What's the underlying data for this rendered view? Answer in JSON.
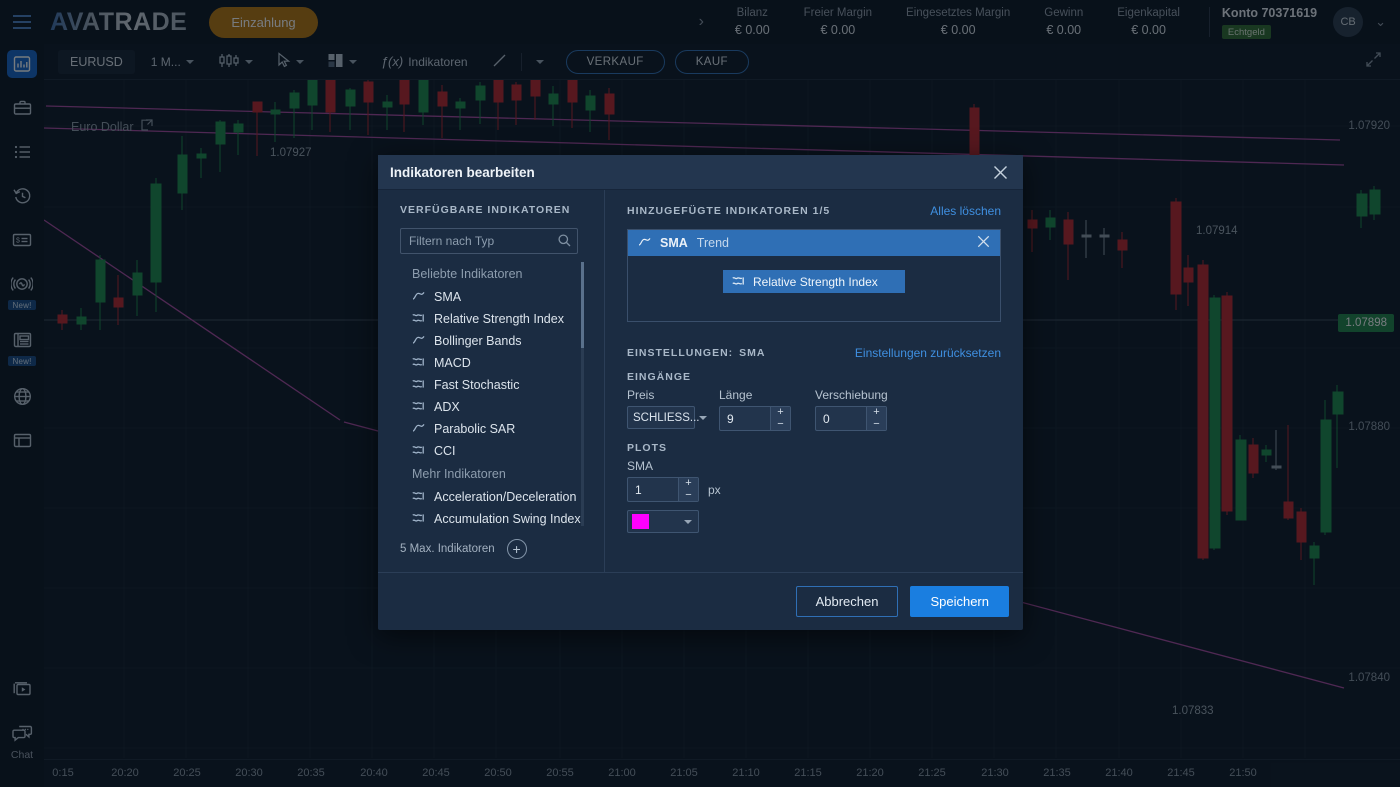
{
  "header": {
    "brand": "AVATRADE",
    "deposit_label": "Einzahlung",
    "expand_arrow": "›",
    "stats": [
      {
        "label": "Bilanz",
        "value": "€ 0.00"
      },
      {
        "label": "Freier Margin",
        "value": "€ 0.00"
      },
      {
        "label": "Eingesetztes Margin",
        "value": "€ 0.00"
      },
      {
        "label": "Gewinn",
        "value": "€ 0.00"
      },
      {
        "label": "Eigenkapital",
        "value": "€ 0.00"
      }
    ],
    "account_name": "Konto 70371619",
    "account_badge": "Echtgeld",
    "avatar_initials": "CB"
  },
  "sidebar": {
    "items": [
      {
        "name": "chart",
        "icon": "bar-chart-icon",
        "active": true,
        "badge": ""
      },
      {
        "name": "portfolio",
        "icon": "briefcase-icon",
        "active": false,
        "badge": ""
      },
      {
        "name": "watchlist",
        "icon": "list-icon",
        "active": false,
        "badge": ""
      },
      {
        "name": "history",
        "icon": "history-clock-icon",
        "active": false,
        "badge": ""
      },
      {
        "name": "transactions",
        "icon": "money-card-icon",
        "active": false,
        "badge": ""
      },
      {
        "name": "signals",
        "icon": "pulse-signal-icon",
        "active": false,
        "badge": "New!"
      },
      {
        "name": "news",
        "icon": "newspaper-icon",
        "active": false,
        "badge": "New!"
      },
      {
        "name": "web",
        "icon": "globe-icon",
        "active": false,
        "badge": ""
      },
      {
        "name": "windows",
        "icon": "window-icon",
        "active": false,
        "badge": ""
      }
    ],
    "bottom": [
      {
        "name": "video",
        "icon": "video-play-icon",
        "label": ""
      },
      {
        "name": "chat",
        "icon": "chat-bubbles-icon",
        "label": "Chat"
      }
    ]
  },
  "toolbar": {
    "symbol": "EURUSD",
    "timeframe": "1 M...",
    "chart_type_icon": "candlestick-icon",
    "cursor_icon": "cursor-arrow-icon",
    "layout_icon": "layout-split-icon",
    "indicators_label": "Indikatoren",
    "indicators_prefix": "ƒ(x)",
    "drawing_icon": "line-tool-icon",
    "sell_label": "VERKAUF",
    "buy_label": "KAUF",
    "expand_icon": "fullscreen-icon"
  },
  "chart": {
    "title": "Euro Dollar",
    "popout_icon": "popout-icon",
    "current_price": "1.07898",
    "axis_prices": [
      "1.07920",
      "1.07880",
      "1.07840"
    ],
    "trend_labels": [
      "1.07927",
      "1.07914",
      "1.07833"
    ],
    "time_ticks": [
      "0:15",
      "20:20",
      "20:25",
      "20:30",
      "20:35",
      "20:40",
      "20:45",
      "20:50",
      "20:55",
      "21:00",
      "21:05",
      "21:10",
      "21:15",
      "21:20",
      "21:25",
      "21:30",
      "21:35",
      "21:40",
      "21:45",
      "21:50"
    ],
    "colors": {
      "up": "#1b8a4b",
      "down": "#b9252a",
      "trendline": "#a6489d",
      "grid": "#16222f",
      "price_tag_bg": "#1f8348"
    }
  },
  "chart_data": {
    "type": "candlestick",
    "title": "Euro Dollar",
    "xlabel": "",
    "ylabel": "",
    "ylim": [
      1.07815,
      1.07935
    ],
    "y_ticks": [
      1.0792,
      1.0788,
      1.0784
    ],
    "current_price": 1.07898,
    "trend_annotations": [
      1.07927,
      1.07914,
      1.07833
    ],
    "x_ticks": [
      "0:15",
      "20:20",
      "20:25",
      "20:30",
      "20:35",
      "20:40",
      "20:45",
      "20:50",
      "20:55",
      "21:00",
      "21:05",
      "21:10",
      "21:15",
      "21:20",
      "21:25",
      "21:30",
      "21:35",
      "21:40",
      "21:45",
      "21:50"
    ]
  },
  "modal": {
    "title": "Indikatoren bearbeiten",
    "close_icon": "close-icon",
    "left": {
      "heading": "VERFÜGBARE INDIKATOREN",
      "filter_placeholder": "Filtern nach Typ",
      "filter_value": "",
      "search_icon": "search-icon",
      "groups": [
        {
          "label": "Beliebte Indikatoren",
          "items": [
            {
              "label": "SMA",
              "icon": "trend-line-icon"
            },
            {
              "label": "Relative Strength Index",
              "icon": "oscillator-icon"
            },
            {
              "label": "Bollinger Bands",
              "icon": "trend-line-icon"
            },
            {
              "label": "MACD",
              "icon": "oscillator-icon"
            },
            {
              "label": "Fast Stochastic",
              "icon": "oscillator-icon"
            },
            {
              "label": "ADX",
              "icon": "oscillator-icon"
            },
            {
              "label": "Parabolic SAR",
              "icon": "trend-line-icon"
            },
            {
              "label": "CCI",
              "icon": "oscillator-icon"
            }
          ]
        },
        {
          "label": "Mehr Indikatoren",
          "items": [
            {
              "label": "Acceleration/Deceleration",
              "icon": "oscillator-icon"
            },
            {
              "label": "Accumulation Swing Index",
              "icon": "oscillator-icon"
            }
          ]
        }
      ],
      "max_label": "5 Max. Indikatoren",
      "add_label": "+"
    },
    "right": {
      "heading": "HINZUGEFÜGTE INDIKATOREN 1/5",
      "clear_all": "Alles löschen",
      "added": [
        {
          "name": "SMA",
          "type": "Trend",
          "icon": "trend-line-icon",
          "remove_icon": "close-icon"
        }
      ],
      "dragging": {
        "label": "Relative Strength Index",
        "icon": "oscillator-icon"
      },
      "settings_heading": "EINSTELLUNGEN:",
      "settings_target": "SMA",
      "reset_link": "Einstellungen zurücksetzen",
      "inputs_heading": "EINGÄNGE",
      "price_label": "Preis",
      "price_value": "SCHLIESS...",
      "length_label": "Länge",
      "length_value": "9",
      "offset_label": "Verschiebung",
      "offset_value": "0",
      "plots_heading": "PLOTS",
      "plot_name": "SMA",
      "plot_width": "1",
      "plot_width_unit": "px",
      "plot_color": "#ff00ff",
      "plus": "+",
      "minus": "−"
    },
    "footer": {
      "cancel_label": "Abbrechen",
      "save_label": "Speichern"
    }
  }
}
